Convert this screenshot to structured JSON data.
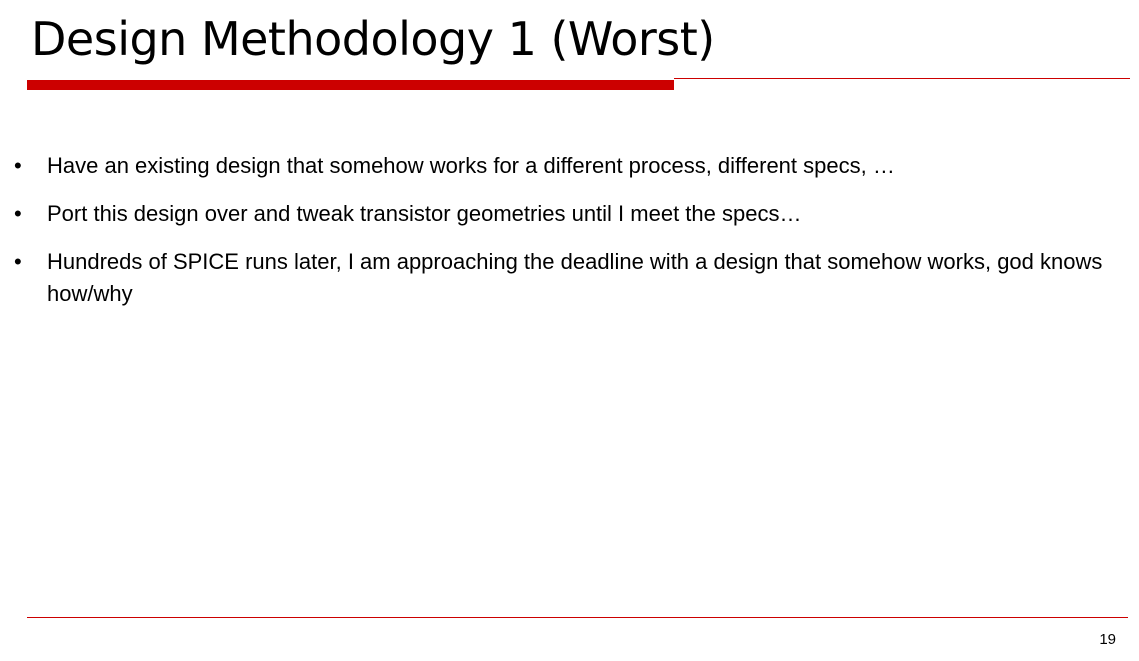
{
  "slide": {
    "title": "Design Methodology 1 (Worst)",
    "accent_color": "#cc0000",
    "bullets": [
      {
        "text": "Have an existing design that somehow works for a different process, different specs, …"
      },
      {
        "text": "Port this design over and tweak transistor geometries until I meet the specs…"
      },
      {
        "text": "Hundreds of SPICE runs later, I am approaching the deadline with a design that somehow works, god knows how/why"
      }
    ],
    "page_number": "19"
  }
}
